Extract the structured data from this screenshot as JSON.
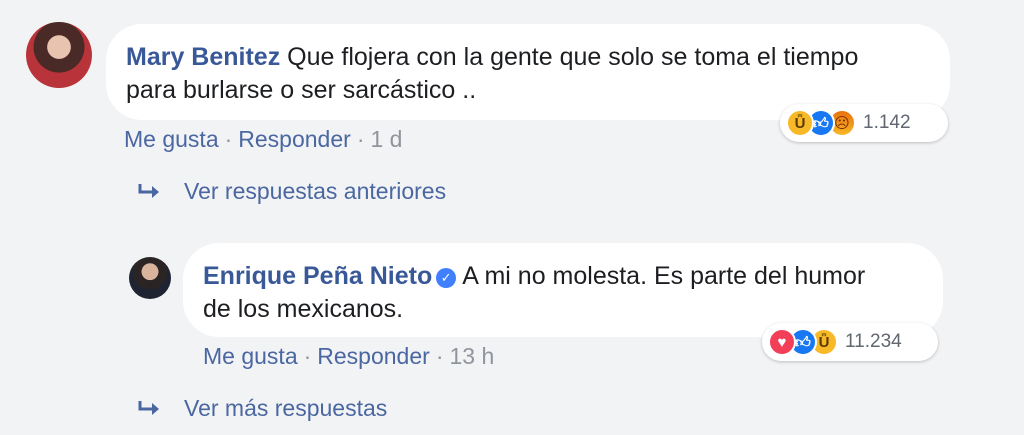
{
  "comments": [
    {
      "author": "Mary Benitez",
      "text_line1": "Que flojera con la gente que solo se toma el tiempo",
      "text_line2": "para burlarse o ser sarcástico ..",
      "like_label": "Me gusta",
      "reply_label": "Responder",
      "time": "1 d",
      "reactions": [
        "haha",
        "like",
        "angry"
      ],
      "reaction_count": "1.142"
    },
    {
      "author": "Enrique Peña Nieto",
      "verified": true,
      "text_line1": "A mi no molesta. Es parte del humor",
      "text_line2": "de los mexicanos.",
      "like_label": "Me gusta",
      "reply_label": "Responder",
      "time": "13 h",
      "reactions": [
        "love",
        "like",
        "haha"
      ],
      "reaction_count": "11.234"
    }
  ],
  "links": {
    "previous_replies": "Ver respuestas anteriores",
    "more_replies": "Ver más respuestas"
  },
  "icons": {
    "reply_arrow": "reply-arrow-icon",
    "verified": "verified-badge-icon"
  },
  "colors": {
    "background": "#f2f3f5",
    "author": "#385898",
    "link": "#4b67a1",
    "verified": "#4080ff"
  }
}
